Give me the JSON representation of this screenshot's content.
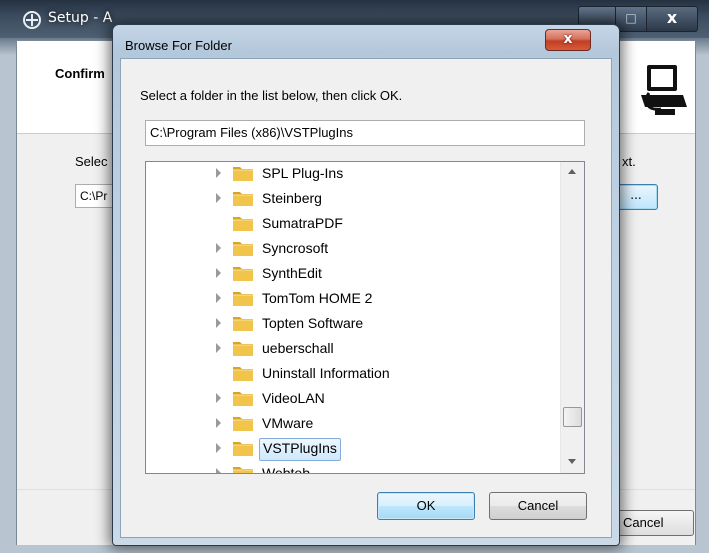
{
  "setup_window": {
    "title": "Setup - A",
    "heading": "Confirm",
    "label_left": "Selec",
    "label_right": "xt.",
    "path_value": "C:\\Pr",
    "browse_label": "...",
    "cancel_label": "Cancel",
    "max_glyph": "□",
    "close_glyph": "x"
  },
  "dialog": {
    "title": "Browse For Folder",
    "close_glyph": "x",
    "instruction": "Select a folder in the list below, then click OK.",
    "path_value": "C:\\Program Files (x86)\\VSTPlugIns",
    "ok_label": "OK",
    "cancel_label": "Cancel",
    "scrollbar_position": 0.88
  },
  "tree": {
    "items": [
      {
        "label": "SPL Plug-Ins",
        "expandable": true,
        "selected": false
      },
      {
        "label": "Steinberg",
        "expandable": true,
        "selected": false
      },
      {
        "label": "SumatraPDF",
        "expandable": false,
        "selected": false
      },
      {
        "label": "Syncrosoft",
        "expandable": true,
        "selected": false
      },
      {
        "label": "SynthEdit",
        "expandable": true,
        "selected": false
      },
      {
        "label": "TomTom HOME 2",
        "expandable": true,
        "selected": false
      },
      {
        "label": "Topten Software",
        "expandable": true,
        "selected": false
      },
      {
        "label": "ueberschall",
        "expandable": true,
        "selected": false
      },
      {
        "label": "Uninstall Information",
        "expandable": false,
        "selected": false
      },
      {
        "label": "VideoLAN",
        "expandable": true,
        "selected": false
      },
      {
        "label": "VMware",
        "expandable": true,
        "selected": false
      },
      {
        "label": "VSTPlugIns",
        "expandable": true,
        "selected": true
      },
      {
        "label": "Webteb",
        "expandable": true,
        "selected": false
      }
    ]
  },
  "colors": {
    "folder_yellow": "#f1c54b",
    "selection_border": "#84acdd",
    "close_red": "#c23e25"
  }
}
